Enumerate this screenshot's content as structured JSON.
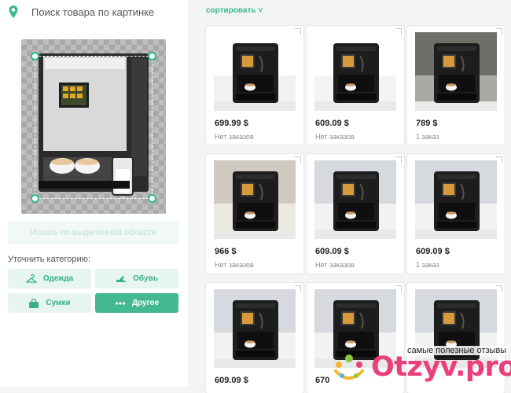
{
  "header": {
    "title": "Поиск товара по картинке",
    "pin_icon": "location-pin-icon"
  },
  "search_button": {
    "label": "Искать по выделенной области"
  },
  "refine": {
    "label": "Уточнить категорию:"
  },
  "categories": [
    {
      "label": "Одежда",
      "icon": "hanger-icon",
      "active": false
    },
    {
      "label": "Обувь",
      "icon": "shoe-icon",
      "active": false
    },
    {
      "label": "Сумки",
      "icon": "bag-icon",
      "active": false
    },
    {
      "label": "Другое",
      "icon": "dots-icon",
      "active": true
    }
  ],
  "sort": {
    "label": "сортировать"
  },
  "products": [
    {
      "price": "699.99 $",
      "orders": "Нет заказов"
    },
    {
      "price": "609.09 $",
      "orders": "Нет заказов"
    },
    {
      "price": "789 $",
      "orders": "1 заказ"
    },
    {
      "price": "966 $",
      "orders": "Нет заказов"
    },
    {
      "price": "609.09 $",
      "orders": "Нет заказов"
    },
    {
      "price": "609.09 $",
      "orders": "1 заказ"
    },
    {
      "price": "609.09 $",
      "orders": ""
    },
    {
      "price": "670",
      "orders": ""
    },
    {
      "price": "",
      "orders": ""
    }
  ],
  "watermark": {
    "tagline": "самые полезные отзывы",
    "brand": "Otzyv.pro"
  },
  "colors": {
    "accent": "#43b893",
    "brand_pink": "#ea3f7a"
  }
}
